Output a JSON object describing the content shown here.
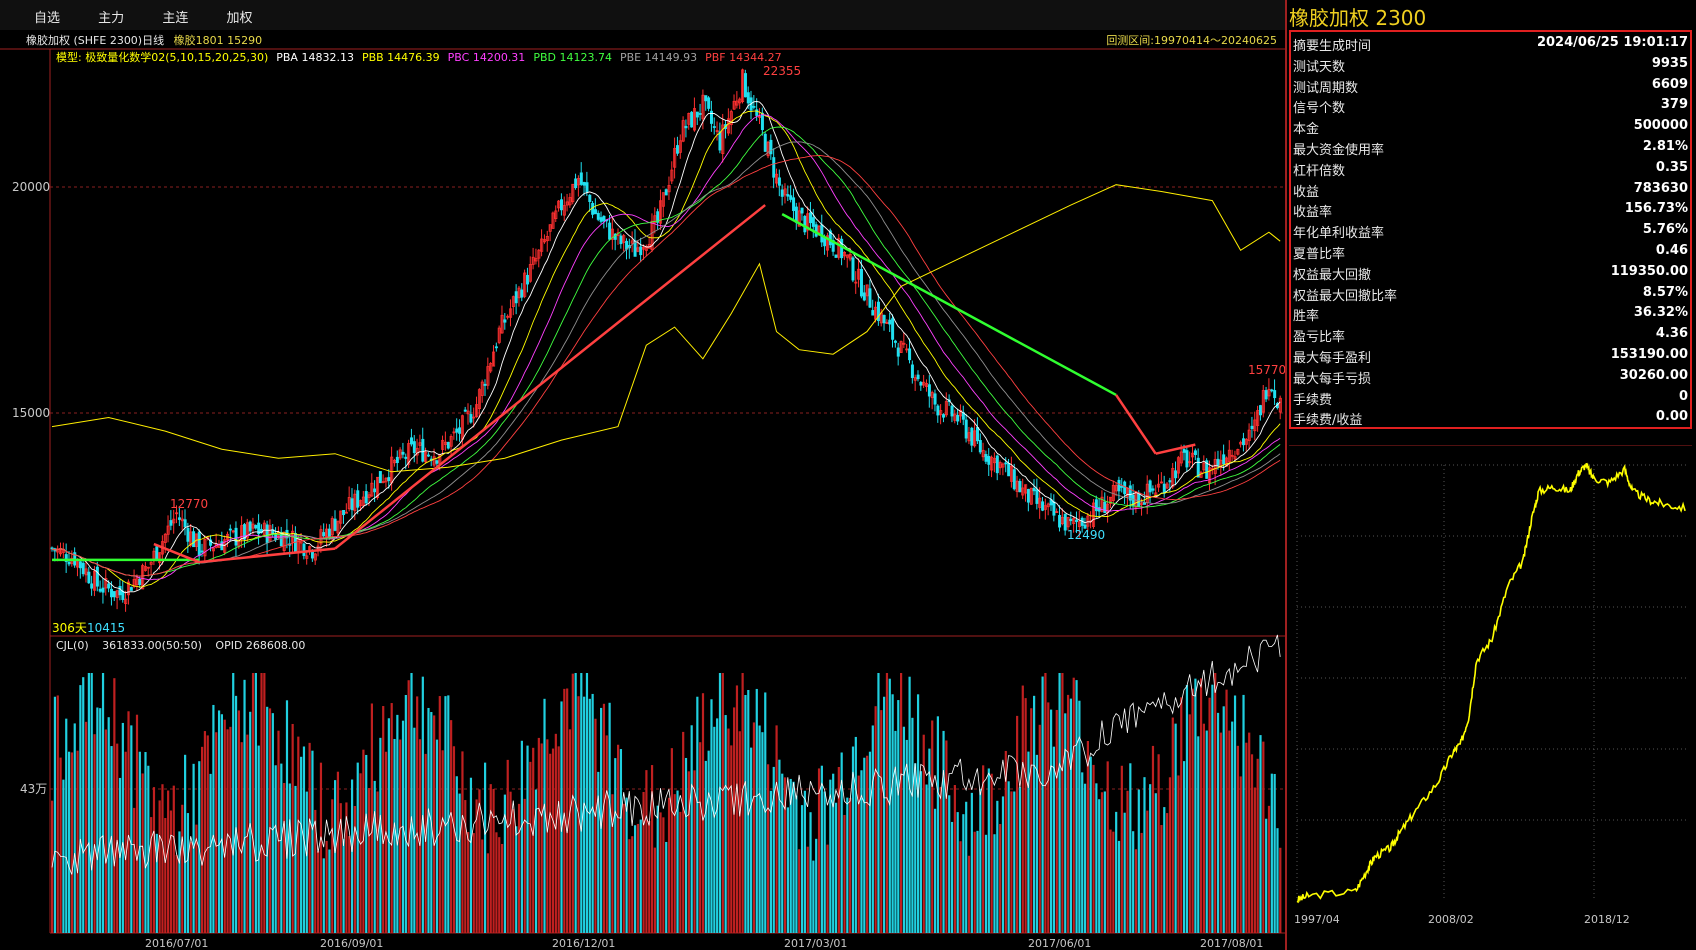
{
  "menu": [
    "自选",
    "主力",
    "主连",
    "加权"
  ],
  "header": {
    "title": "橡胶加权 (SHFE 2300)日线",
    "subtitle": "橡胶1801  15290",
    "backtest": "回测区间:19970414～20240625"
  },
  "indicators": [
    {
      "text": "模型: 极致量化数学02(5,10,15,20,25,30)",
      "color": "#ffff00"
    },
    {
      "text": "PBA 14832.13",
      "color": "#ffffff"
    },
    {
      "text": "PBB 14476.39",
      "color": "#ffff00"
    },
    {
      "text": "PBC 14200.31",
      "color": "#ff40ff"
    },
    {
      "text": "PBD 14123.74",
      "color": "#40ff40"
    },
    {
      "text": "PBE 14149.93",
      "color": "#a0a0a0"
    },
    {
      "text": "PBF 14344.27",
      "color": "#ff4040"
    }
  ],
  "main_chart": {
    "y_ticks": [
      "20000",
      "15000"
    ],
    "annotations": {
      "high": "22355",
      "low_left": "10415",
      "peak_left": "12770",
      "low_right": "12490",
      "recent_high": "15770",
      "days": "306天"
    }
  },
  "volume": {
    "header": [
      "CJL(0)",
      "361833.00(50:50)",
      "OPID 268608.00"
    ],
    "y_tick": "43万"
  },
  "x_axis": [
    "2016/07/01",
    "2016/09/01",
    "2016/12/01",
    "2017/03/01",
    "2017/06/01",
    "2017/08/01"
  ],
  "right_panel": {
    "title": "橡胶加权  2300",
    "summary": [
      {
        "k": "摘要生成时间",
        "v": "2024/06/25 19:01:17"
      },
      {
        "k": "测试天数",
        "v": "9935"
      },
      {
        "k": "测试周期数",
        "v": "6609"
      },
      {
        "k": "信号个数",
        "v": "379"
      },
      {
        "k": "本金",
        "v": "500000"
      },
      {
        "k": "最大资金使用率",
        "v": "2.81%"
      },
      {
        "k": "杠杆倍数",
        "v": "0.35"
      },
      {
        "k": "收益",
        "v": "783630"
      },
      {
        "k": "收益率",
        "v": "156.73%"
      },
      {
        "k": "年化单利收益率",
        "v": "5.76%"
      },
      {
        "k": "夏普比率",
        "v": "0.46"
      },
      {
        "k": "权益最大回撤",
        "v": "119350.00"
      },
      {
        "k": "权益最大回撤比率",
        "v": "8.57%"
      },
      {
        "k": "胜率",
        "v": "36.32%"
      },
      {
        "k": "盈亏比率",
        "v": "4.36"
      },
      {
        "k": "最大每手盈利",
        "v": "153190.00"
      },
      {
        "k": "最大每手亏损",
        "v": "30260.00"
      },
      {
        "k": "手续费",
        "v": "0"
      },
      {
        "k": "手续费/收益",
        "v": "0.00"
      }
    ],
    "equity_x_axis": [
      "1997/04",
      "2008/02",
      "2018/12"
    ]
  },
  "chart_data": {
    "type": "candlestick",
    "price_path": [
      [
        0,
        12000
      ],
      [
        8,
        11800
      ],
      [
        16,
        11200
      ],
      [
        24,
        11000
      ],
      [
        34,
        11600
      ],
      [
        44,
        12770
      ],
      [
        52,
        12000
      ],
      [
        62,
        12200
      ],
      [
        72,
        12400
      ],
      [
        82,
        12300
      ],
      [
        92,
        12000
      ],
      [
        100,
        12600
      ],
      [
        110,
        13200
      ],
      [
        120,
        13800
      ],
      [
        128,
        14200
      ],
      [
        136,
        14100
      ],
      [
        144,
        14600
      ],
      [
        150,
        15200
      ],
      [
        158,
        16800
      ],
      [
        166,
        17800
      ],
      [
        172,
        18500
      ],
      [
        180,
        19600
      ],
      [
        186,
        20200
      ],
      [
        192,
        19400
      ],
      [
        200,
        18800
      ],
      [
        206,
        18600
      ],
      [
        214,
        19200
      ],
      [
        222,
        21200
      ],
      [
        230,
        21800
      ],
      [
        236,
        21000
      ],
      [
        244,
        22355
      ],
      [
        252,
        21000
      ],
      [
        258,
        19800
      ],
      [
        266,
        19200
      ],
      [
        272,
        19000
      ],
      [
        280,
        18500
      ],
      [
        288,
        17600
      ],
      [
        296,
        16800
      ],
      [
        304,
        16000
      ],
      [
        312,
        15200
      ],
      [
        320,
        14900
      ],
      [
        328,
        14200
      ],
      [
        336,
        13800
      ],
      [
        344,
        13200
      ],
      [
        352,
        12800
      ],
      [
        360,
        12490
      ],
      [
        368,
        12800
      ],
      [
        376,
        13200
      ],
      [
        384,
        13100
      ],
      [
        392,
        13400
      ],
      [
        400,
        14000
      ],
      [
        408,
        13700
      ],
      [
        416,
        14200
      ],
      [
        424,
        14500
      ],
      [
        430,
        15770
      ],
      [
        434,
        15200
      ]
    ],
    "equity_curve": [
      [
        0,
        0.0
      ],
      [
        0.03,
        0.01
      ],
      [
        0.15,
        0.02
      ],
      [
        0.18,
        0.07
      ],
      [
        0.2,
        0.1
      ],
      [
        0.24,
        0.12
      ],
      [
        0.26,
        0.15
      ],
      [
        0.3,
        0.2
      ],
      [
        0.36,
        0.27
      ],
      [
        0.4,
        0.34
      ],
      [
        0.42,
        0.36
      ],
      [
        0.44,
        0.42
      ],
      [
        0.46,
        0.55
      ],
      [
        0.5,
        0.6
      ],
      [
        0.54,
        0.72
      ],
      [
        0.58,
        0.78
      ],
      [
        0.6,
        0.87
      ],
      [
        0.62,
        0.94
      ],
      [
        0.66,
        0.95
      ],
      [
        0.7,
        0.94
      ],
      [
        0.72,
        0.98
      ],
      [
        0.74,
        1.0
      ],
      [
        0.76,
        0.97
      ],
      [
        0.8,
        0.96
      ],
      [
        0.84,
        0.99
      ],
      [
        0.86,
        0.94
      ],
      [
        0.9,
        0.92
      ],
      [
        0.94,
        0.91
      ],
      [
        1.0,
        0.9
      ]
    ]
  }
}
